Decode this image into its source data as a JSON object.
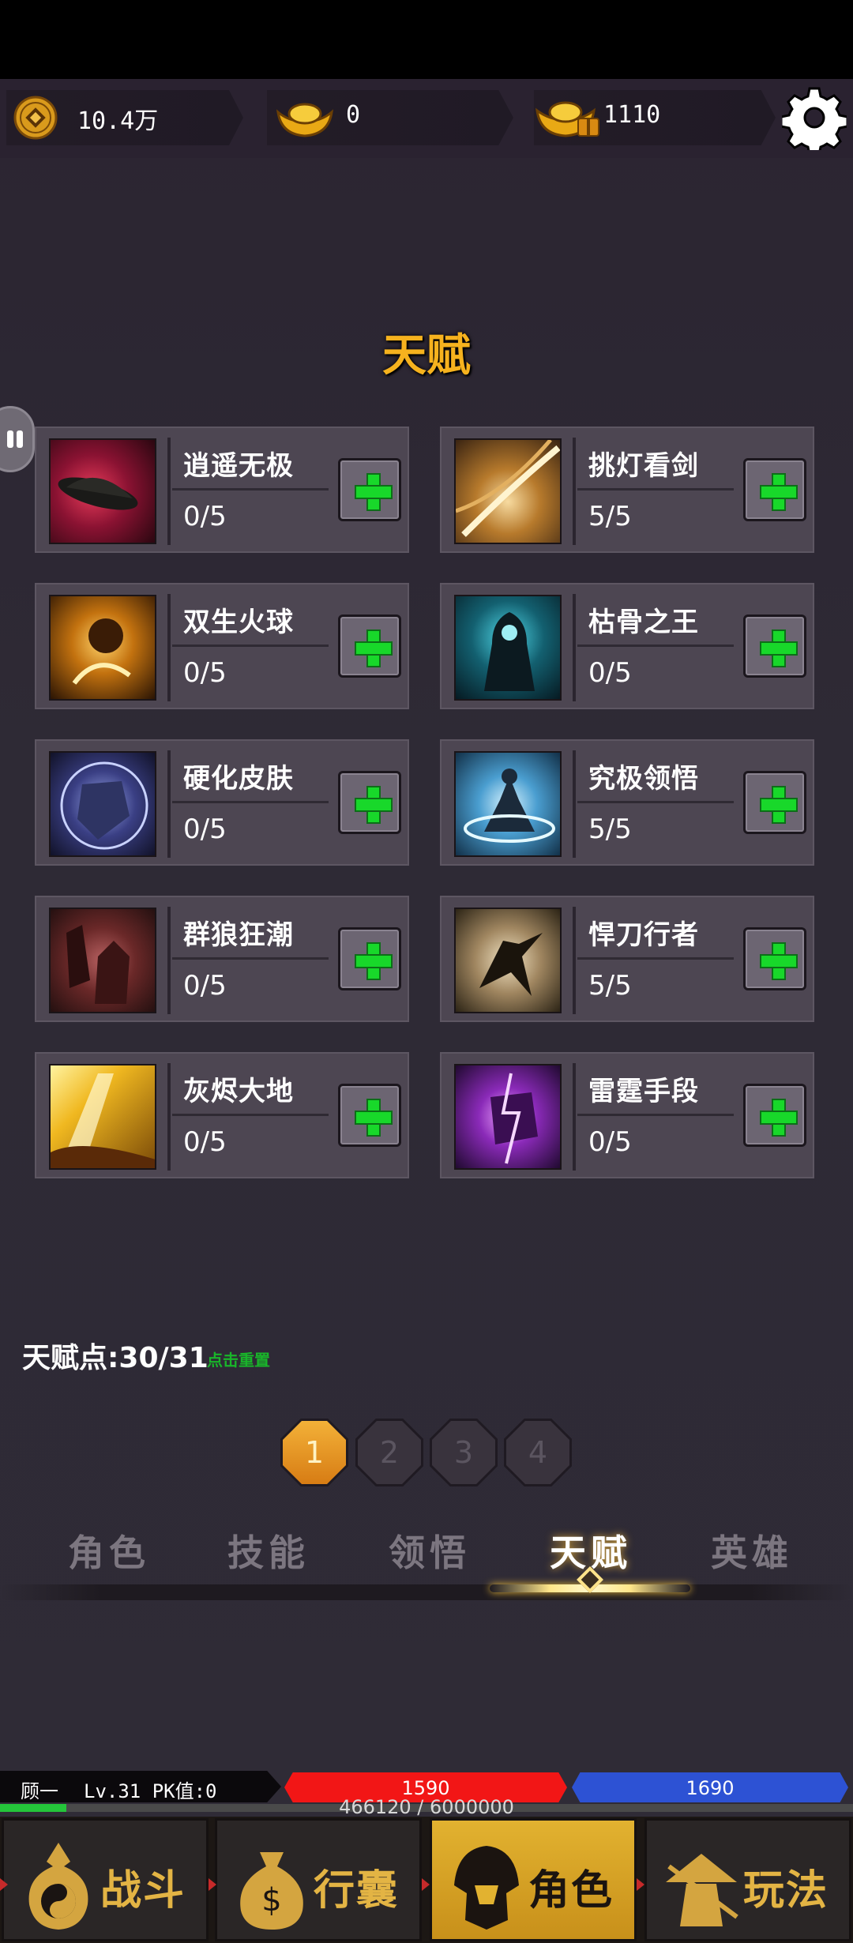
{
  "currency": {
    "copper": "10.4万",
    "gold_ingot": "0",
    "gift_ingot": "1110"
  },
  "page_title": "天赋",
  "talents": [
    {
      "name": "逍遥无极",
      "level": "0/5",
      "icon": "bamboo-hat-icon"
    },
    {
      "name": "挑灯看剑",
      "level": "5/5",
      "icon": "sword-slash-icon"
    },
    {
      "name": "双生火球",
      "level": "0/5",
      "icon": "twin-fireball-icon"
    },
    {
      "name": "枯骨之王",
      "level": "0/5",
      "icon": "bone-king-icon"
    },
    {
      "name": "硬化皮肤",
      "level": "0/5",
      "icon": "hardened-skin-icon"
    },
    {
      "name": "究极领悟",
      "level": "5/5",
      "icon": "meditation-icon"
    },
    {
      "name": "群狼狂潮",
      "level": "0/5",
      "icon": "wolf-pack-icon"
    },
    {
      "name": "悍刀行者",
      "level": "5/5",
      "icon": "blade-walker-icon"
    },
    {
      "name": "灰烬大地",
      "level": "0/5",
      "icon": "ash-earth-icon"
    },
    {
      "name": "雷霆手段",
      "level": "0/5",
      "icon": "thunder-fist-icon"
    }
  ],
  "talent_points": "天赋点:30/31",
  "reset_label": "点击重置",
  "pages": [
    "1",
    "2",
    "3",
    "4"
  ],
  "active_page": 1,
  "tabs": [
    "角色",
    "技能",
    "领悟",
    "天赋",
    "英雄"
  ],
  "active_tab": "天赋",
  "player": {
    "name": "顾一",
    "level": "Lv.31 PK值:0",
    "hp": "1590",
    "mp": "1690",
    "exp_text": "466120 / 6000000",
    "exp_fraction": 0.078
  },
  "nav": [
    "战斗",
    "行囊",
    "角色",
    "玩法"
  ],
  "active_nav": "角色",
  "colors": {
    "title": "#f6b21e",
    "plus_green": "#18d82a",
    "hp_red": "#f21616",
    "mp_blue": "#2d52d4",
    "nav_active": "#e2b230"
  }
}
